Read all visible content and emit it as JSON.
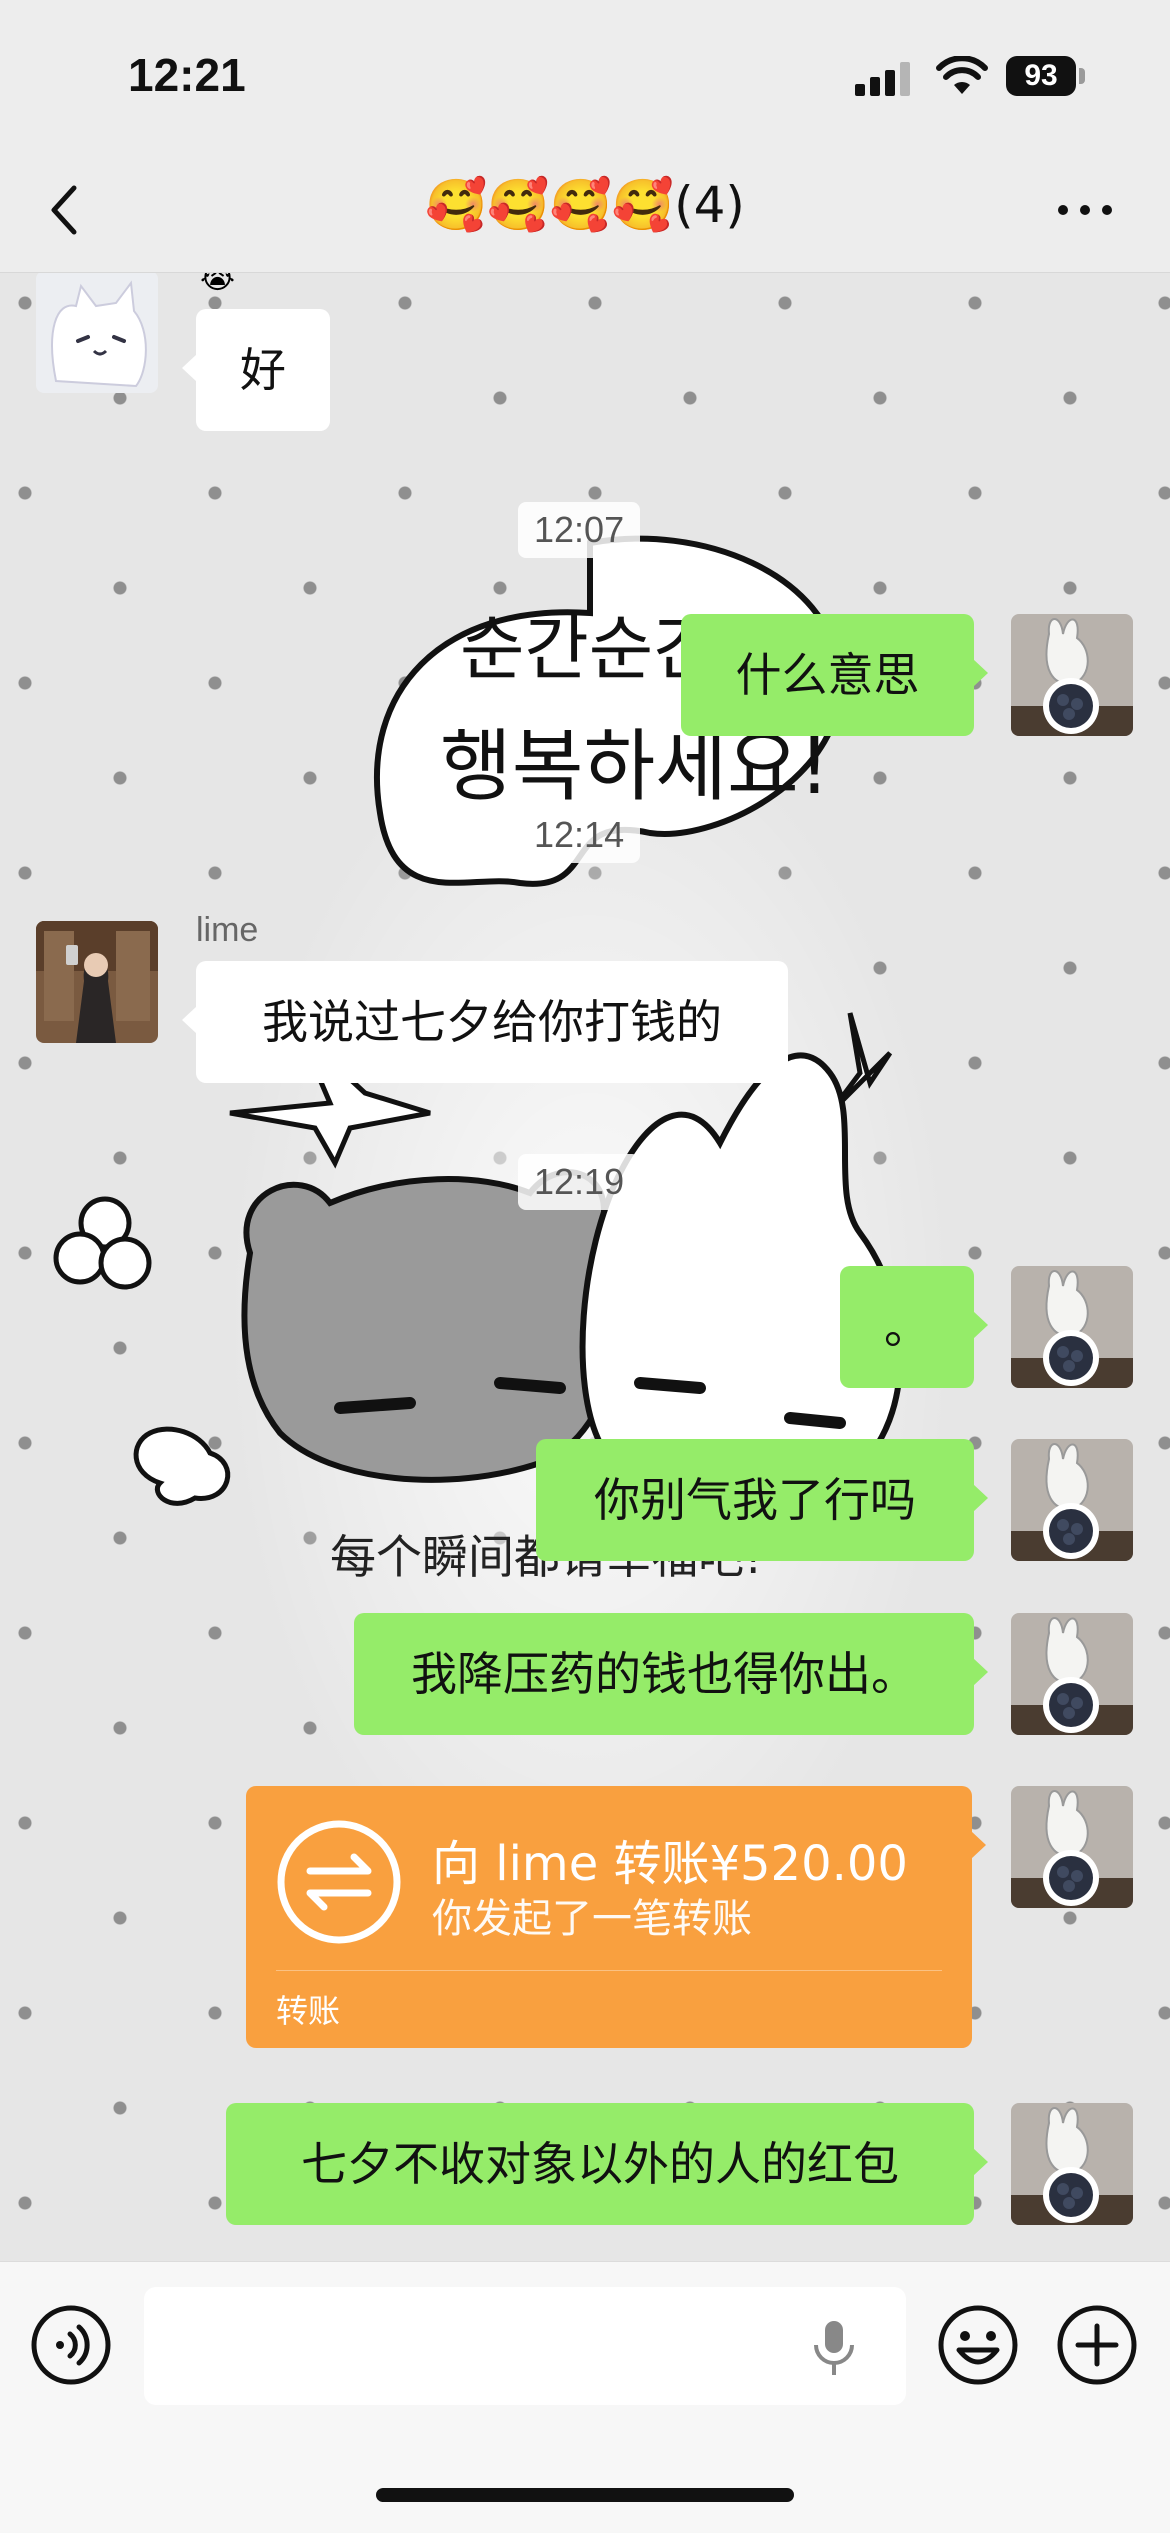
{
  "status_bar": {
    "time": "12:21",
    "battery": "93"
  },
  "nav": {
    "title": "🥰🥰🥰🥰(4)"
  },
  "messages": [
    {
      "side": "left",
      "type": "text",
      "text": "好"
    },
    {
      "type": "time",
      "text": "12:07"
    },
    {
      "side": "right",
      "type": "text",
      "text": "什么意思"
    },
    {
      "type": "time",
      "text": "12:14"
    },
    {
      "side": "left",
      "type": "text",
      "sender": "lime",
      "text": "我说过七夕给你打钱的"
    },
    {
      "type": "time",
      "text": "12:19"
    },
    {
      "side": "right",
      "type": "text",
      "text": "。"
    },
    {
      "side": "right",
      "type": "text",
      "text": "你别气我了行吗"
    },
    {
      "side": "right",
      "type": "text",
      "text": "我降压药的钱也得你出。"
    },
    {
      "side": "right",
      "type": "transfer",
      "title": "向 lime 转账¥520.00",
      "subtitle": "你发起了一笔转账",
      "label": "转账"
    },
    {
      "side": "right",
      "type": "text",
      "text": "七夕不收对象以外的人的红包"
    }
  ],
  "wallpaper": {
    "korean_text_line1": "순간순간",
    "korean_text_line2": "행복하세요!",
    "chinese_caption": "每个瞬间都请幸福吧!"
  },
  "icons": {
    "back": "chevron-left-icon",
    "more": "more-dots-icon",
    "voice": "voice-mode-icon",
    "mic": "microphone-icon",
    "emoji": "emoji-icon",
    "plus": "plus-icon",
    "transfer": "transfer-arrows-icon"
  },
  "colors": {
    "green_bubble": "#95ec69",
    "transfer_card": "#f9a03f",
    "background": "#ededed"
  }
}
